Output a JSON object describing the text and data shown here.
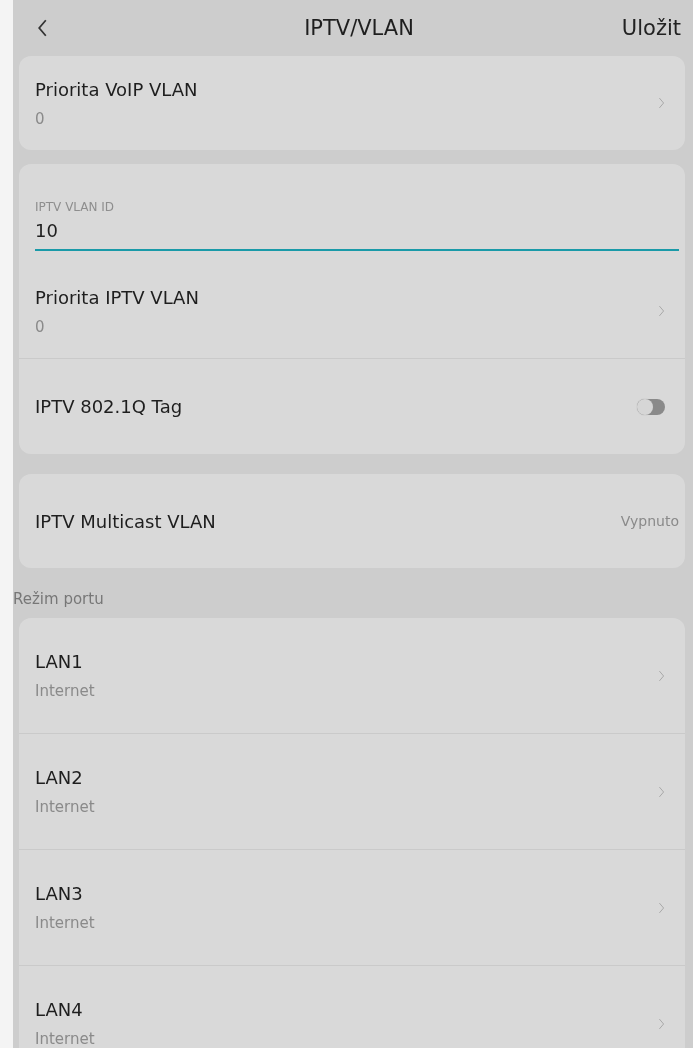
{
  "header": {
    "title": "IPTV/VLAN",
    "action": "Uložit"
  },
  "cards": [
    {
      "rows": [
        {
          "kind": "select",
          "label": "Priorita VoIP VLAN",
          "value": "0"
        }
      ]
    },
    {
      "rows": [
        {
          "kind": "field",
          "label": "IPTV VLAN ID",
          "value": "10"
        },
        {
          "kind": "select",
          "label": "Priorita IPTV VLAN",
          "value": "0"
        },
        {
          "kind": "toggle",
          "label": "IPTV 802.1Q Tag",
          "on": false
        }
      ]
    },
    {
      "rows": [
        {
          "kind": "status",
          "label": "IPTV Multicast VLAN",
          "value": "Vypnuto"
        }
      ]
    }
  ],
  "port_section": {
    "title": "Režim portu",
    "ports": [
      {
        "label": "LAN1",
        "value": "Internet"
      },
      {
        "label": "LAN2",
        "value": "Internet"
      },
      {
        "label": "LAN3",
        "value": "Internet"
      },
      {
        "label": "LAN4",
        "value": "Internet"
      }
    ]
  }
}
